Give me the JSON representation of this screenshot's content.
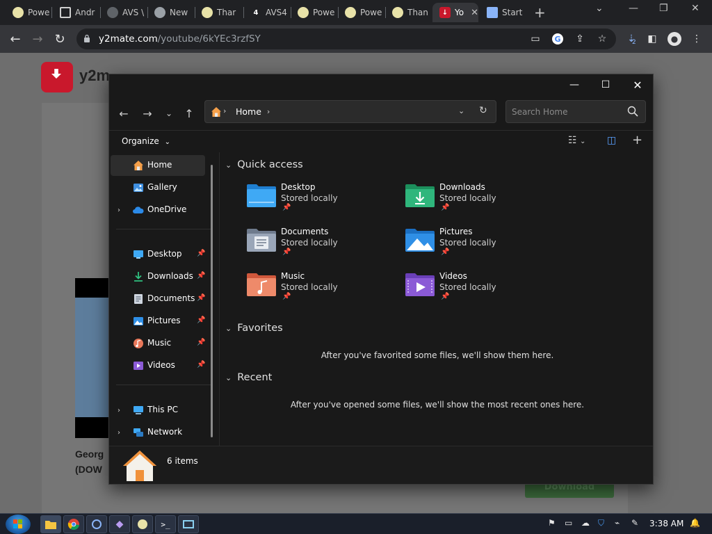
{
  "browser": {
    "tabs": [
      {
        "label": "Powe",
        "icon": "powerpoint-icon",
        "color": "#e8e2a8"
      },
      {
        "label": "Andr",
        "icon": "bank-icon",
        "color": "#cfcfcf"
      },
      {
        "label": "AVS \\",
        "icon": "globe-icon",
        "color": "#9aa0a6"
      },
      {
        "label": "New",
        "icon": "chrome-icon",
        "color": "#9aa0a6"
      },
      {
        "label": "Thar",
        "icon": "powerpoint-icon",
        "color": "#e8e2a8"
      },
      {
        "label": "AVS4",
        "icon": "number-four-icon",
        "color": "#ffffff"
      },
      {
        "label": "Powe",
        "icon": "powerpoint-icon",
        "color": "#e8e2a8"
      },
      {
        "label": "Powe",
        "icon": "powerpoint-icon",
        "color": "#e8e2a8"
      },
      {
        "label": "Than",
        "icon": "powerpoint-icon",
        "color": "#e8e2a8"
      },
      {
        "label": "Yo",
        "icon": "y2mate-icon",
        "color": "#c9182c"
      },
      {
        "label": "Start",
        "icon": "document-icon",
        "color": "#8ab4f8"
      }
    ],
    "url_host": "y2mate.com",
    "url_path": "/youtube/6kYEc3rzfSY",
    "extension_badge": "2"
  },
  "page": {
    "site_name": "y2m",
    "video_title_line1": "Georg",
    "video_title_line2": "(DOW",
    "download_label": "Download"
  },
  "explorer": {
    "breadcrumb": "Home",
    "search_placeholder": "Search Home",
    "organize_label": "Organize",
    "nav": {
      "home": "Home",
      "gallery": "Gallery",
      "onedrive": "OneDrive",
      "desktop": "Desktop",
      "downloads": "Downloads",
      "documents": "Documents",
      "pictures": "Pictures",
      "music": "Music",
      "videos": "Videos",
      "this_pc": "This PC",
      "network": "Network"
    },
    "quick_access_title": "Quick access",
    "quick_access": [
      {
        "name": "Desktop",
        "status": "Stored locally",
        "color": "#3fa9f5"
      },
      {
        "name": "Downloads",
        "status": "Stored locally",
        "color": "#2fb67c"
      },
      {
        "name": "Documents",
        "status": "Stored locally",
        "color": "#9aa6b8"
      },
      {
        "name": "Pictures",
        "status": "Stored locally",
        "color": "#2f8fe6"
      },
      {
        "name": "Music",
        "status": "Stored locally",
        "color": "#e9785a"
      },
      {
        "name": "Videos",
        "status": "Stored locally",
        "color": "#8b5ad6"
      }
    ],
    "favorites_title": "Favorites",
    "favorites_empty": "After you've favorited some files, we'll show them here.",
    "recent_title": "Recent",
    "recent_empty": "After you've opened some files, we'll show the most recent ones here.",
    "status_count": "6 items"
  },
  "taskbar": {
    "clock": "3:38 AM"
  }
}
